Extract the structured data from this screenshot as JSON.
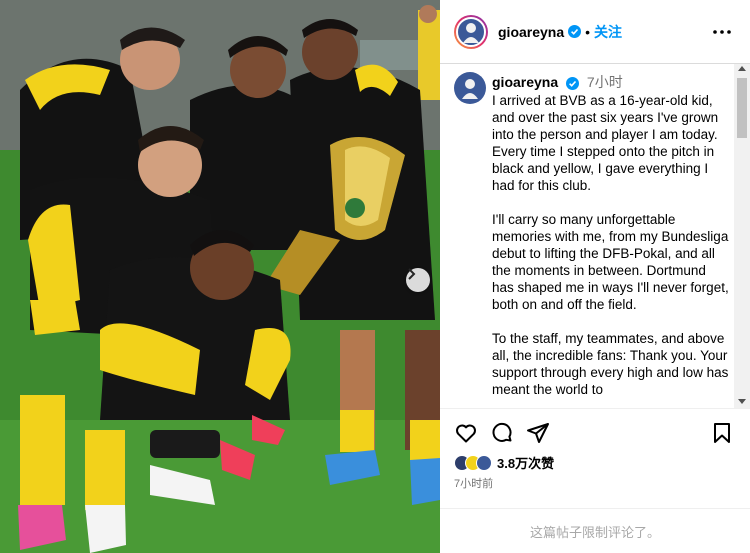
{
  "post": {
    "username": "gioareyna",
    "follow_label": "关注",
    "separator": "•",
    "caption": {
      "username": "gioareyna",
      "time": "7小时",
      "paragraphs": [
        "I arrived at BVB as a 16-year-old kid, and over the past six years I've grown into the person and player I am today. Every time I stepped onto the pitch in black and yellow, I gave everything I had for this club.",
        "I'll carry so many unforgettable memories with me, from my Bundesliga debut to lifting the DFB-Pokal, and all the moments in between. Dortmund has shaped me in ways I'll never forget, both on and off the field.",
        "To the staff, my teammates, and above all, the incredible fans: Thank you. Your support through every high and low has meant the world to"
      ]
    },
    "likes": "3.8万次赞",
    "timestamp": "7小时前",
    "comments_restricted": "这篇帖子限制评论了。"
  },
  "icons": {
    "verified": "verified-badge-icon",
    "more": "more-options-icon",
    "like": "heart-icon",
    "comment": "comment-icon",
    "share": "share-icon",
    "save": "bookmark-icon",
    "next": "chevron-right-icon"
  },
  "colors": {
    "accent": "#0095f6",
    "secondary_text": "#737373",
    "muted_text": "#a8a8a8",
    "bvb_yellow": "#f7d117",
    "jersey_black": "#121212"
  }
}
